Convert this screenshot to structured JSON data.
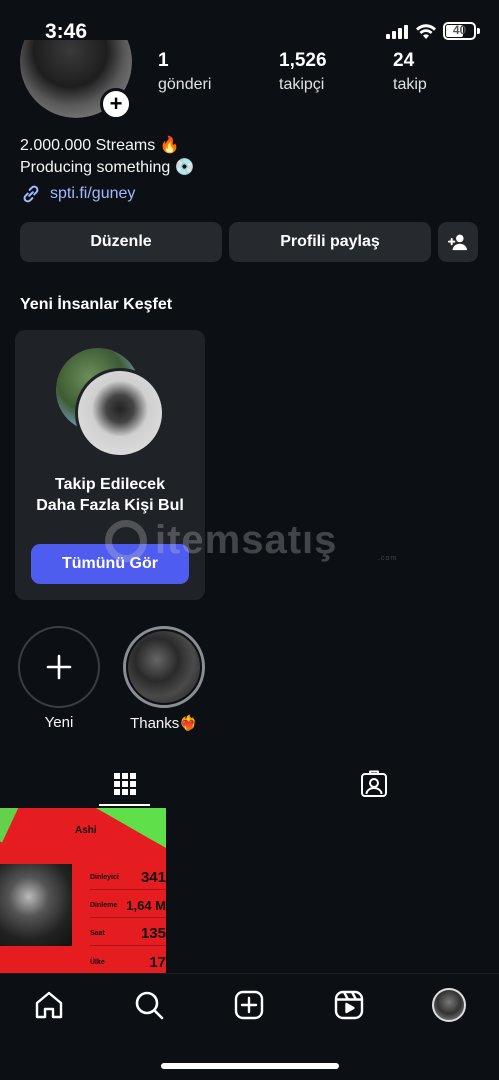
{
  "status_bar": {
    "time": "3:46",
    "battery": "40"
  },
  "profile": {
    "stats": [
      {
        "value": "1",
        "label": "gönderi"
      },
      {
        "value": "1,526",
        "label": "takipçi"
      },
      {
        "value": "24",
        "label": "takip"
      }
    ],
    "bio_line1": "2.000.000 Streams 🔥",
    "bio_line2": "Producing something 💿",
    "link": "spti.fi/guney",
    "edit_button": "Düzenle",
    "share_button": "Profili paylaş"
  },
  "discover": {
    "title": "Yeni İnsanlar Keşfet",
    "card_line1": "Takip Edilecek",
    "card_line2": "Daha Fazla Kişi Bul",
    "see_all": "Tümünü Gör"
  },
  "watermark": {
    "brand": "itemsatış",
    "sub": ".com"
  },
  "highlights": [
    {
      "label": "Yeni"
    },
    {
      "label": "Thanks❤️‍🔥"
    }
  ],
  "post": {
    "title": "Ashi",
    "rows": [
      {
        "label": "Dinleyici",
        "value": "341"
      },
      {
        "label": "Dinleme",
        "value": "1,64 M"
      },
      {
        "label": "Saat",
        "value": "135"
      },
      {
        "label": "Ülke",
        "value": "17"
      }
    ]
  },
  "icons": {
    "grid": "grid-icon",
    "tagged": "tagged-icon",
    "home": "home-icon",
    "search": "search-icon",
    "create": "plus-square-icon",
    "reels": "reels-icon"
  },
  "colors": {
    "background": "#0c1014",
    "button": "#262a2f",
    "accent": "#4e5cf0",
    "link": "#a3b6ff",
    "post_red": "#e51c20"
  }
}
